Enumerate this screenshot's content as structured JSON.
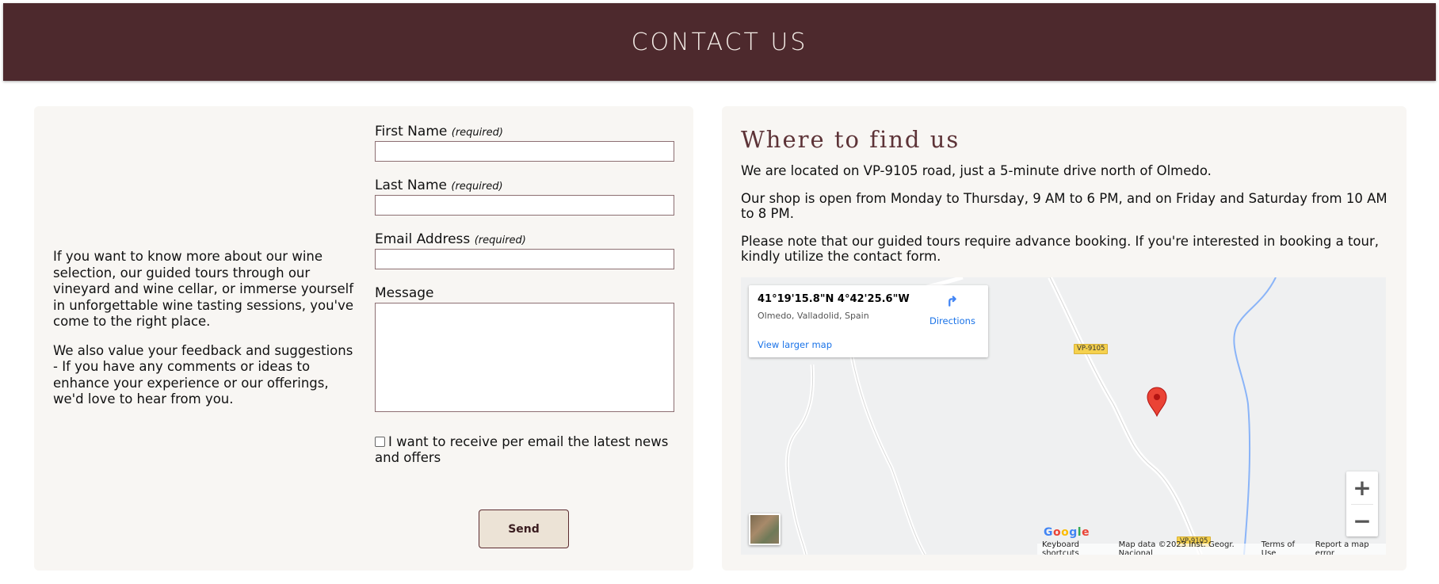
{
  "header": {
    "title": "CONTACT US"
  },
  "intro": {
    "paragraphs": [
      "If you want to know more about our wine selection, our guided tours through our vineyard and wine cellar, or immerse yourself in unforgettable wine tasting sessions, you've come to the right place.",
      "We also value your feedback and suggestions - If you have any comments or ideas to enhance your experience or our offerings, we'd love to hear from you."
    ]
  },
  "form": {
    "first_name_label": "First Name",
    "last_name_label": "Last Name",
    "email_label": "Email Address",
    "required_note": "(required)",
    "message_label": "Message",
    "newsletter_label": "I want to receive per email the latest news and offers",
    "send_label": "Send"
  },
  "location": {
    "title": "Where to find us",
    "paragraphs": [
      "We are located on VP-9105 road, just a 5-minute drive north of Olmedo.",
      "Our shop is open from Monday to Thursday, 9 AM to 6 PM, and on Friday and Saturday from 10 AM to 8 PM.",
      "Please note that our guided tours require advance booking. If you're interested in booking a tour, kindly utilize the contact form."
    ]
  },
  "map": {
    "coords": "41°19'15.8\"N 4°42'25.6\"W",
    "place": "Olmedo, Valladolid, Spain",
    "directions_label": "Directions",
    "larger_map_label": "View larger map",
    "road_label": "VP-9105",
    "logo": "Google",
    "attribution": [
      "Keyboard shortcuts",
      "Map data ©2023 Inst. Geogr. Nacional",
      "Terms of Use",
      "Report a map error"
    ],
    "zoom_in": "+",
    "zoom_out": "−"
  }
}
